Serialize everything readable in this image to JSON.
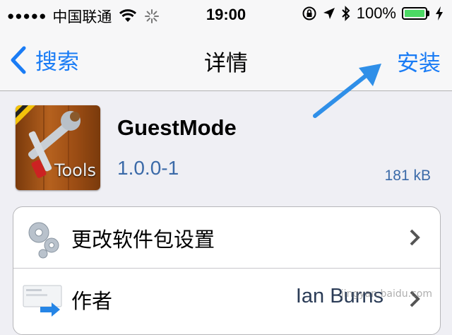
{
  "status_bar": {
    "signal_dots": "●●●●●",
    "carrier": "中国联通",
    "time": "19:00",
    "battery_percent": "100%",
    "battery_level": 1.0,
    "battery_color": "#4cd964"
  },
  "nav": {
    "back_label": "搜索",
    "title": "详情",
    "action_label": "安装",
    "accent_color": "#1a7cf5"
  },
  "package": {
    "icon_text": "Tools",
    "name": "GuestMode",
    "version": "1.0.0-1",
    "size": "181 kB"
  },
  "rows": [
    {
      "label": "更改软件包设置",
      "value": "",
      "icon": "gears-icon"
    },
    {
      "label": "作者",
      "value": "Ian Burns",
      "icon": "contact-card-icon"
    }
  ],
  "watermark": "jingyan.baidu.com"
}
